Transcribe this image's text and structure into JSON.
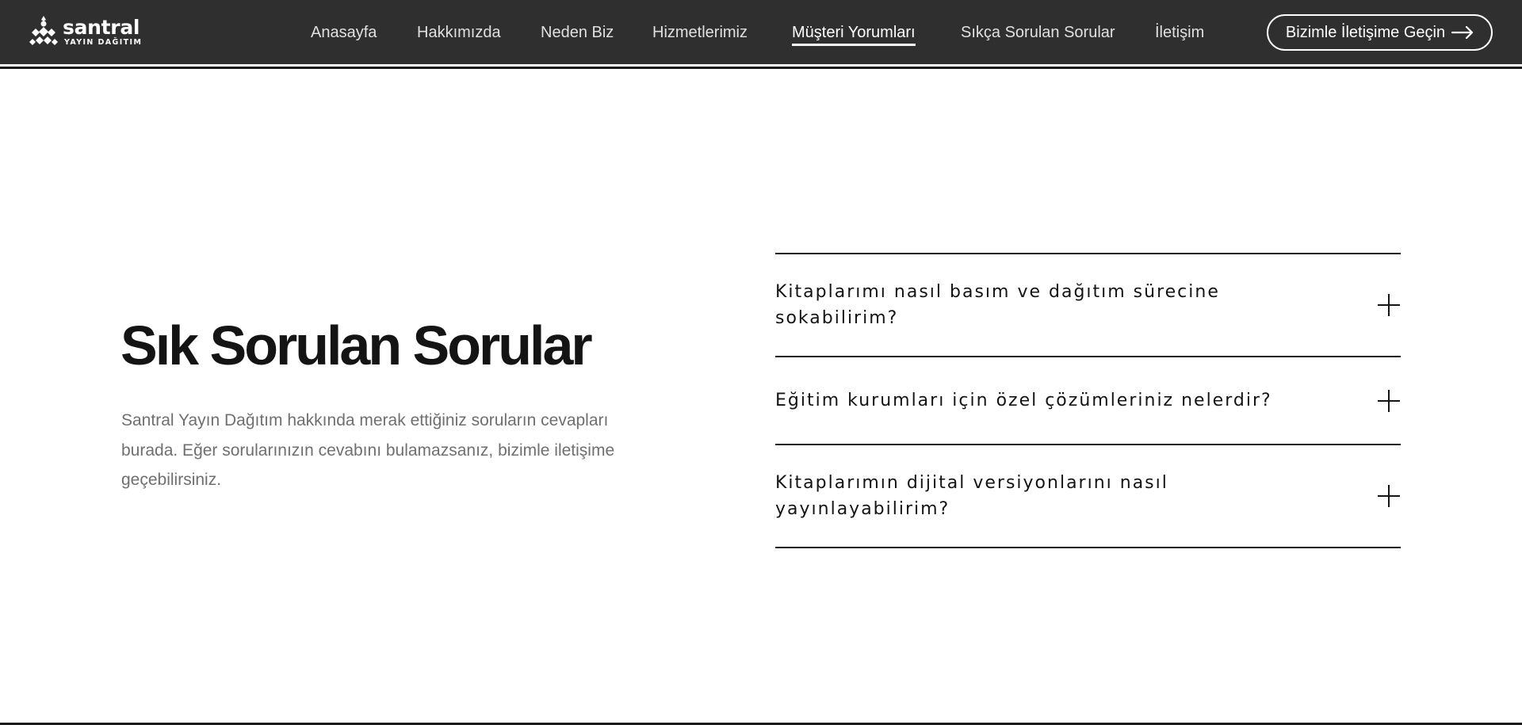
{
  "brand": {
    "name": "santral",
    "subtitle": "YAYIN DAĞITIM"
  },
  "nav": {
    "items": [
      {
        "label": "Anasayfa"
      },
      {
        "label": "Hakkımızda"
      },
      {
        "label": "Neden Biz"
      },
      {
        "label": "Hizmetlerimiz"
      },
      {
        "label": "Müşteri Yorumları",
        "active": true
      },
      {
        "label": "Sıkça Sorulan Sorular"
      },
      {
        "label": "İletişim"
      }
    ],
    "cta_label": "Bizimle İletişime Geçin"
  },
  "faq_section": {
    "title": "Sık Sorulan Sorular",
    "description": "Santral Yayın Dağıtım hakkında merak ettiğiniz soruların cevapları burada. Eğer sorularınızın cevabını bulamazsanız, bizimle iletişime geçebilirsiniz.",
    "questions": [
      {
        "question": "Kitaplarımı nasıl basım ve dağıtım sürecine sokabilirim?",
        "icon": "plus-icon"
      },
      {
        "question": "Eğitim kurumları için özel çözümleriniz nelerdir?",
        "icon": "plus-icon"
      },
      {
        "question": "Kitaplarımın dijital versiyonlarını nasıl yayınlayabilirim?",
        "icon": "plus-icon"
      }
    ]
  },
  "colors": {
    "header_bg": "#2f2f2f",
    "text_dark": "#141414",
    "text_muted": "#6f6f6f",
    "accent": "#ffffff"
  }
}
